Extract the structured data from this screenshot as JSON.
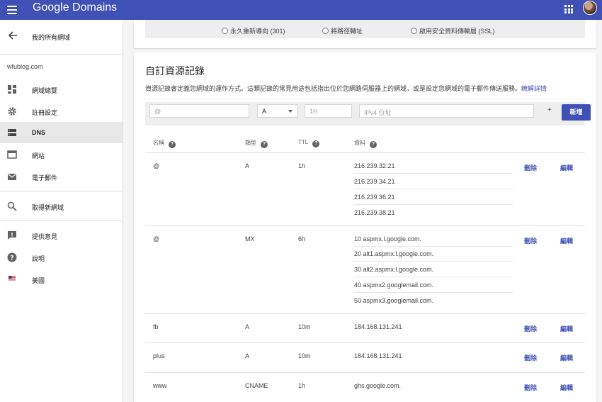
{
  "app": {
    "title_google": "Google",
    "title_product": "Domains"
  },
  "sidebar": {
    "back_label": "我的所有網域",
    "domain": "wfublog.com",
    "items": [
      {
        "label": "網域總覽",
        "icon": "dashboard-icon"
      },
      {
        "label": "註冊設定",
        "icon": "gear-icon"
      },
      {
        "label": "DNS",
        "icon": "dns-icon",
        "active": true
      },
      {
        "label": "網站",
        "icon": "website-icon"
      },
      {
        "label": "電子郵件",
        "icon": "email-icon"
      },
      {
        "label": "取得新網域",
        "icon": "search-icon"
      },
      {
        "label": "提供意見",
        "icon": "feedback-icon"
      },
      {
        "label": "說明",
        "icon": "help-icon"
      },
      {
        "label": "美國",
        "icon": "us-flag-icon"
      }
    ]
  },
  "forwarding_options": {
    "permanent": "永久重新導向 (301)",
    "path": "將路徑轉址",
    "ssl": "啟用安全資料傳輸層 (SSL)"
  },
  "custom_records": {
    "title": "自訂資源記錄",
    "description": "資源記錄會定義您網域的運作方式。這類記錄的常見用途包括指出位於您網路伺服器上的網域，或是設定您網域的電子郵件傳送服務。",
    "learn_more": "瞭解詳情",
    "add_bar": {
      "name_placeholder": "@",
      "type_value": "A",
      "ttl_placeholder": "1H",
      "data_placeholder": "IPv4 位址",
      "plus": "+",
      "add_button": "新增"
    },
    "columns": {
      "name": "名稱",
      "type": "類型",
      "ttl": "TTL",
      "data": "資料"
    },
    "delete_label": "刪除",
    "edit_label": "編輯",
    "records": [
      {
        "name": "@",
        "type": "A",
        "ttl": "1h",
        "data": [
          "216.239.32.21",
          "216.239.34.21",
          "216.239.36.21",
          "216.239.38.21"
        ]
      },
      {
        "name": "@",
        "type": "MX",
        "ttl": "6h",
        "data": [
          "10 aspmx.l.google.com.",
          "20 alt1.aspmx.l.google.com.",
          "30 alt2.aspmx.l.google.com.",
          "40 aspmx2.googlemail.com.",
          "50 aspmx3.googlemail.com."
        ]
      },
      {
        "name": "fb",
        "type": "A",
        "ttl": "10m",
        "data": [
          "184.168.131.241"
        ]
      },
      {
        "name": "plus",
        "type": "A",
        "ttl": "10m",
        "data": [
          "184.168.131.241"
        ]
      },
      {
        "name": "www",
        "type": "CNAME",
        "ttl": "1h",
        "data": [
          "ghs.google.com."
        ]
      }
    ]
  },
  "colors": {
    "primary": "#3f51b5",
    "active_nav": "#e8e8e8"
  }
}
